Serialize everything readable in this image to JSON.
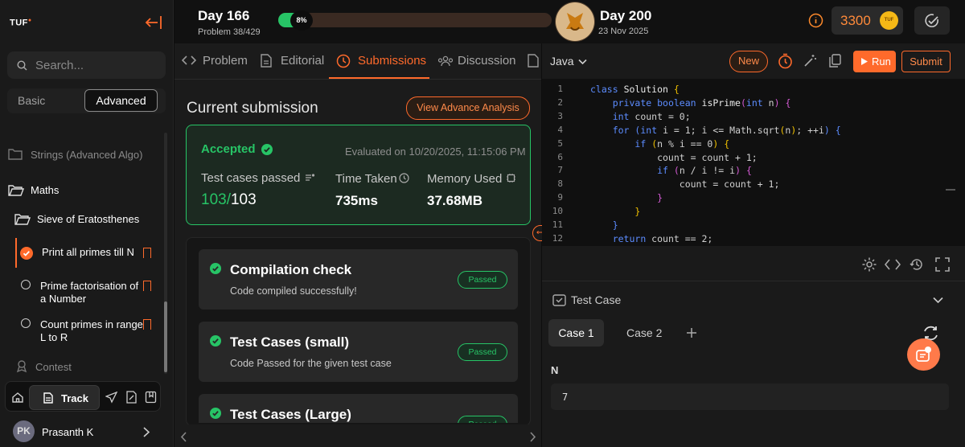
{
  "sidebar": {
    "logo": "TUF",
    "search_placeholder": "Search...",
    "tabs": {
      "basic": "Basic",
      "advanced": "Advanced"
    },
    "items": [
      {
        "label": "Strings (Advanced Algo)"
      },
      {
        "label": "Maths"
      },
      {
        "label": "Sieve of Eratosthenes"
      },
      {
        "label": "Print all primes till N"
      },
      {
        "label_line1": "Prime factorisation of",
        "label_line2": "a Number"
      },
      {
        "label_line1": "Count primes in range",
        "label_line2": "L to R"
      },
      {
        "label": "Contest"
      }
    ],
    "track_label": "Track",
    "user": {
      "initials": "PK",
      "name": "Prasanth K"
    }
  },
  "topbar": {
    "day_current": "Day 166",
    "problem_progress": "Problem 38/429",
    "progress_percent": "8%",
    "progress_value": 0.08,
    "day_target": "Day 200",
    "target_date": "23 Nov 2025",
    "coins": "3300",
    "coin_label": "TUF"
  },
  "middle": {
    "tabs": [
      "Problem",
      "Editorial",
      "Submissions",
      "Discussion"
    ],
    "active_tab": "Submissions",
    "heading": "Current submission",
    "advance_btn": "View Advance Analysis",
    "result": {
      "status": "Accepted",
      "evaluated": "Evaluated on 10/20/2025, 11:15:06 PM",
      "tests_label": "Test cases passed",
      "tests_passed": "103/",
      "tests_total": "103",
      "time_label": "Time Taken",
      "time_value": "735ms",
      "memory_label": "Memory Used",
      "memory_value": "37.68MB"
    },
    "checks": [
      {
        "title": "Compilation check",
        "desc": "Code compiled successfully!",
        "badge": "Passed"
      },
      {
        "title": "Test Cases (small)",
        "desc": "Code Passed for the given test case",
        "badge": "Passed"
      },
      {
        "title": "Test Cases (Large)",
        "desc": "",
        "badge": "Passed"
      }
    ]
  },
  "editor": {
    "language": "Java",
    "new_label": "New",
    "run_label": "Run",
    "submit_label": "Submit",
    "line_numbers": [
      "1",
      "2",
      "3",
      "4",
      "5",
      "6",
      "7",
      "8",
      "9",
      "10",
      "11",
      "12"
    ]
  },
  "testcase": {
    "title": "Test Case",
    "cases": [
      "Case 1",
      "Case 2"
    ],
    "param_name": "N",
    "param_value": "7"
  },
  "colors": {
    "accent": "#ff6a2b",
    "success": "#27c466"
  }
}
